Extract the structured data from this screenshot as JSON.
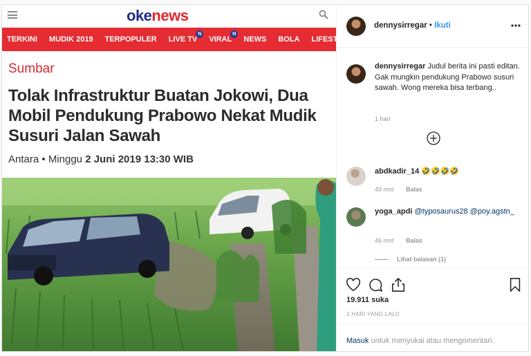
{
  "news": {
    "logo_part1": "oke",
    "logo_part2": "news",
    "nav": [
      {
        "label": "TERKINI",
        "badge": ""
      },
      {
        "label": "MUDIK 2019",
        "badge": ""
      },
      {
        "label": "TERPOPULER",
        "badge": ""
      },
      {
        "label": "LIVE TV",
        "badge": "N"
      },
      {
        "label": "VIRAL",
        "badge": "N"
      },
      {
        "label": "NEWS",
        "badge": ""
      },
      {
        "label": "BOLA",
        "badge": ""
      },
      {
        "label": "LIFESTYLE",
        "badge": ""
      }
    ],
    "category": "Sumbar",
    "headline": "Tolak Infrastruktur Buatan Jokowi, Dua Mobil Pendukung Prabowo Nekat Mudik Susuri Jalan Sawah",
    "source": "Antara",
    "bullet": "•",
    "day": "Minggu",
    "date": "2 Juni 2019 13:30 WIB"
  },
  "ig": {
    "post_user": "dennysirregar",
    "dot": "•",
    "follow_label": "Ikuti",
    "caption_user": "dennysirregar",
    "caption_text": "Judul berita ini pasti editan. Gak mungkin pendukung Prabowo susuri sawah. Wong mereka bisa terbang..",
    "caption_time": "1 hari",
    "comments": [
      {
        "user": "abdkadir_14",
        "text": "🤣🤣🤣🤣",
        "time": "49 mnt",
        "reply": "Balas"
      },
      {
        "user": "yoga_apdi",
        "text": "@typosaurus28 @poy.agstn_",
        "time": "46 mnt",
        "reply": "Balas"
      }
    ],
    "view_replies": "Lihat balasan (1)",
    "likes": "19.911 suka",
    "posted_ago": "1 HARI YANG LALU",
    "login_link": "Masuk",
    "login_rest": " untuk menyukai atau mengomentari."
  },
  "colors": {
    "okenews_red": "#e42c32",
    "okenews_blue": "#1d2c8a",
    "ig_blue": "#3897f0",
    "ig_link": "#003569"
  }
}
